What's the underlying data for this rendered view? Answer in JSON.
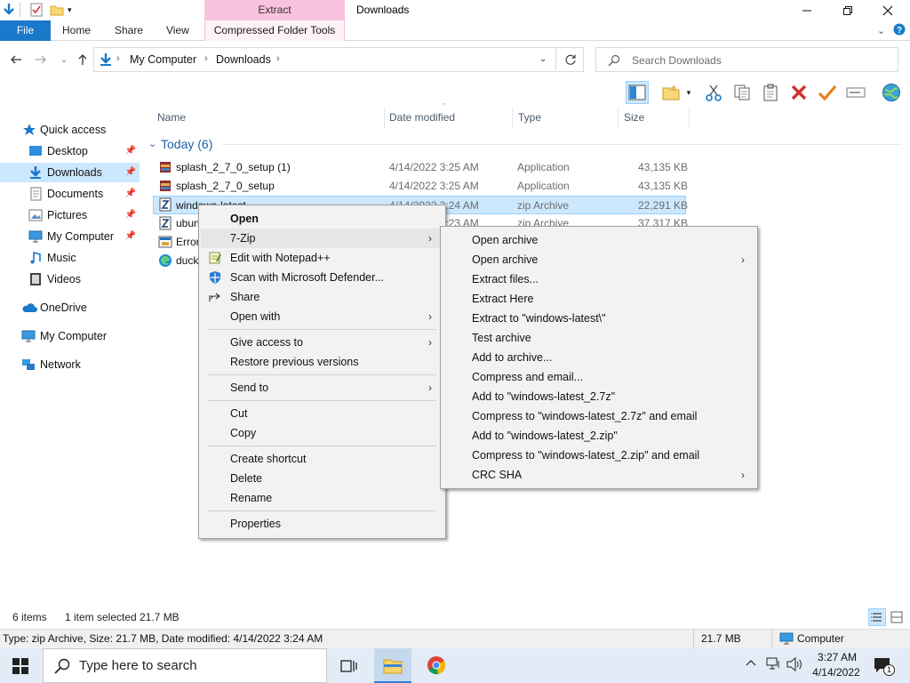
{
  "window": {
    "title": "Downloads",
    "contextual_group": "Extract",
    "controls": {
      "minimize": "minimize",
      "maximize": "maximize",
      "close": "close"
    }
  },
  "ribbon": {
    "file": "File",
    "tabs": [
      "Home",
      "Share",
      "View"
    ],
    "contextual_tab": "Compressed Folder Tools"
  },
  "address": {
    "crumbs": [
      "My Computer",
      "Downloads"
    ],
    "search_placeholder": "Search Downloads"
  },
  "nav": {
    "items": [
      {
        "label": "Quick access",
        "icon": "star-icon"
      },
      {
        "label": "Desktop",
        "icon": "desktop-icon",
        "pinned": true
      },
      {
        "label": "Downloads",
        "icon": "download-icon",
        "pinned": true,
        "selected": true
      },
      {
        "label": "Documents",
        "icon": "documents-icon",
        "pinned": true
      },
      {
        "label": "Pictures",
        "icon": "pictures-icon",
        "pinned": true
      },
      {
        "label": "My Computer",
        "icon": "computer-icon",
        "pinned": true
      },
      {
        "label": "Music",
        "icon": "music-icon"
      },
      {
        "label": "Videos",
        "icon": "videos-icon"
      },
      {
        "label": "OneDrive",
        "icon": "cloud-icon"
      },
      {
        "label": "My Computer",
        "icon": "computer-icon"
      },
      {
        "label": "Network",
        "icon": "network-icon"
      }
    ]
  },
  "files": {
    "columns": [
      "Name",
      "Date modified",
      "Type",
      "Size"
    ],
    "group": "Today (6)",
    "rows": [
      {
        "name": "splash_2_7_0_setup (1)",
        "date": "4/14/2022 3:25 AM",
        "type": "Application",
        "size": "43,135 KB",
        "icon": "installer-icon"
      },
      {
        "name": "splash_2_7_0_setup",
        "date": "4/14/2022 3:25 AM",
        "type": "Application",
        "size": "43,135 KB",
        "icon": "installer-icon"
      },
      {
        "name": "windows-latest",
        "date": "4/14/2022 3:24 AM",
        "type": "zip Archive",
        "size": "22,291 KB",
        "icon": "zip-icon",
        "selected": true
      },
      {
        "name": "ubun",
        "date": "4/14/2022 3:23 AM",
        "type": "zip Archive",
        "size": "37,317 KB",
        "icon": "zip-icon"
      },
      {
        "name": "Error",
        "date": "",
        "type": "",
        "size": "",
        "icon": "error-file-icon"
      },
      {
        "name": "duck",
        "date": "",
        "type": "",
        "size": "",
        "icon": "edge-icon"
      }
    ]
  },
  "context_menu": {
    "items": [
      "Open",
      "7-Zip",
      "Edit with Notepad++",
      "Scan with Microsoft Defender...",
      "Share",
      "Open with",
      "Give access to",
      "Restore previous versions",
      "Send to",
      "Cut",
      "Copy",
      "Create shortcut",
      "Delete",
      "Rename",
      "Properties"
    ]
  },
  "submenu_7zip": {
    "items": [
      "Open archive",
      "Open archive",
      "Extract files...",
      "Extract Here",
      "Extract to \"windows-latest\\\"",
      "Test archive",
      "Add to archive...",
      "Compress and email...",
      "Add to \"windows-latest_2.7z\"",
      "Compress to \"windows-latest_2.7z\" and email",
      "Add to \"windows-latest_2.zip\"",
      "Compress to \"windows-latest_2.zip\" and email",
      "CRC SHA"
    ]
  },
  "status": {
    "item_count": "6 items",
    "selection": "1 item selected",
    "selection_size": "21.7 MB"
  },
  "infobar": {
    "details": "Type: zip Archive, Size: 21.7 MB, Date modified: 4/14/2022 3:24 AM",
    "size": "21.7 MB",
    "location": "Computer"
  },
  "taskbar": {
    "search_placeholder": "Type here to search",
    "time": "3:27 AM",
    "date": "4/14/2022",
    "notifications": "1"
  },
  "colors": {
    "accent": "#1979ca",
    "selection": "#cce8ff",
    "contextual_tab": "#f8c3de"
  }
}
